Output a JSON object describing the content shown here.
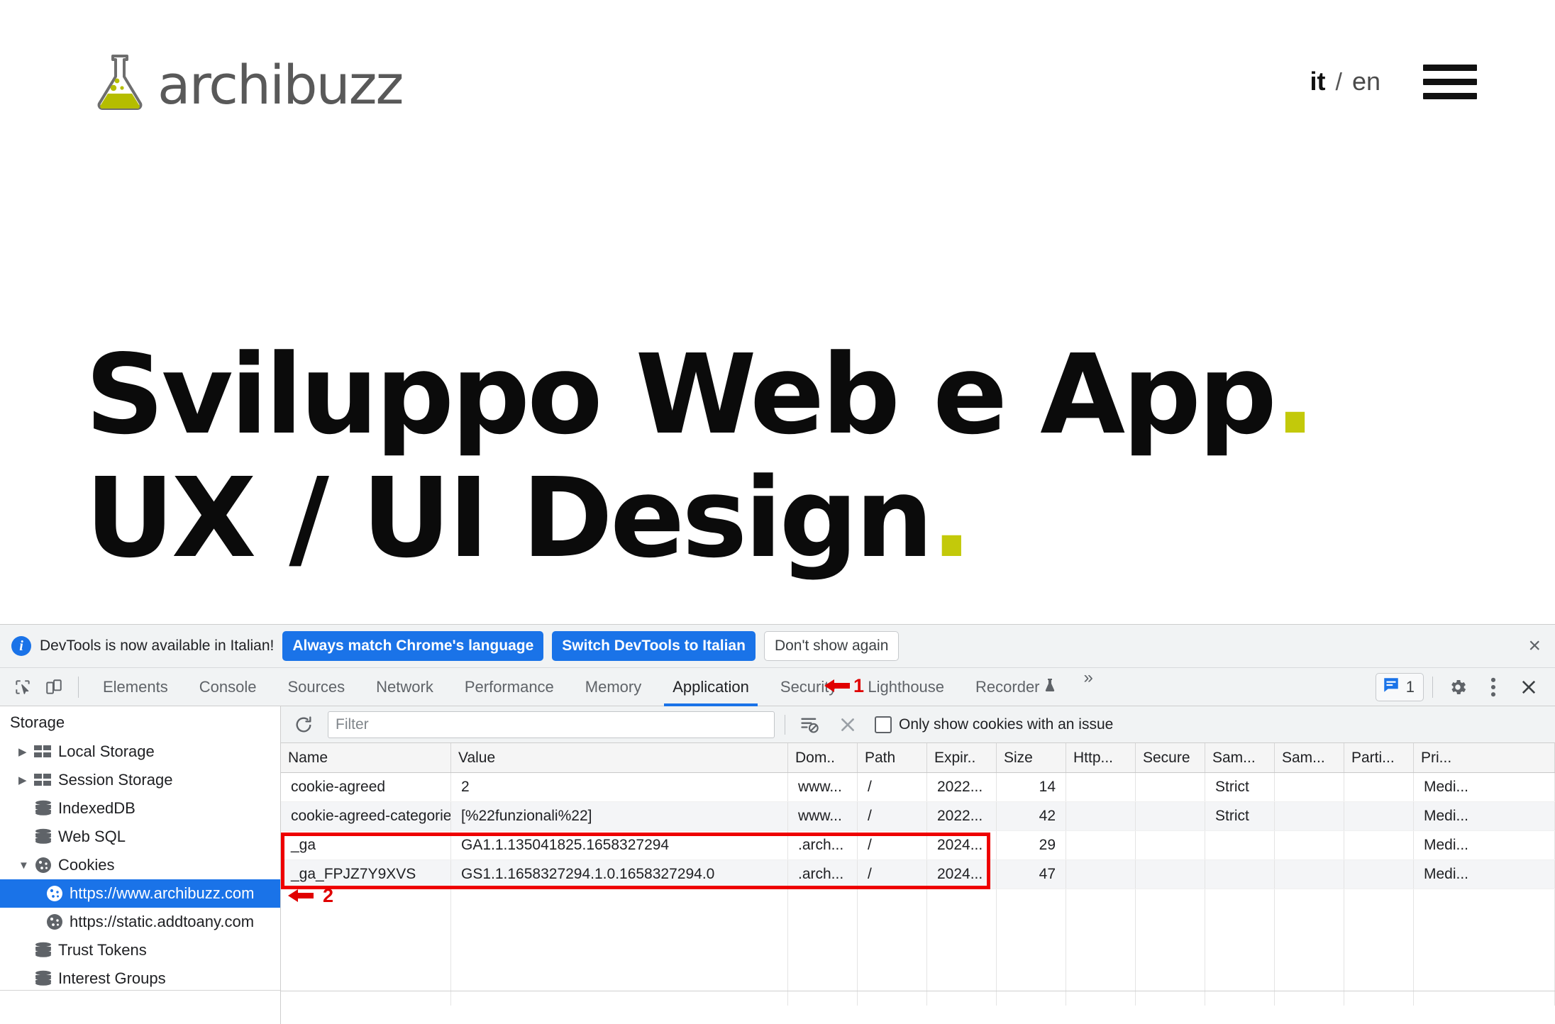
{
  "site": {
    "brand_name": "archibuzz",
    "brand_accent": "#b5bd00",
    "lang_active": "it",
    "lang_separator": "/",
    "lang_alt": "en",
    "hero_line1": "Sviluppo Web e App",
    "hero_line1_dot": ".",
    "hero_line2": "UX / UI Design",
    "hero_line2_dot": "."
  },
  "devtools": {
    "infobar": {
      "message": "DevTools is now available in Italian!",
      "btn_always_match": "Always match Chrome's language",
      "btn_switch": "Switch DevTools to Italian",
      "btn_dont_show": "Don't show again",
      "close": "×"
    },
    "tabs": [
      {
        "label": "Elements",
        "active": false
      },
      {
        "label": "Console",
        "active": false
      },
      {
        "label": "Sources",
        "active": false
      },
      {
        "label": "Network",
        "active": false
      },
      {
        "label": "Performance",
        "active": false
      },
      {
        "label": "Memory",
        "active": false
      },
      {
        "label": "Application",
        "active": true
      },
      {
        "label": "Security",
        "active": false
      },
      {
        "label": "Lighthouse",
        "active": false
      },
      {
        "label": "Recorder",
        "active": false
      }
    ],
    "tab_overflow": "»",
    "message_count": "1",
    "annotations": [
      {
        "id": "1",
        "arrow": "←",
        "label": "1",
        "color": "#e00000"
      },
      {
        "id": "2",
        "arrow": "←",
        "label": "2",
        "color": "#e00000"
      }
    ],
    "sidebar": {
      "title": "Storage",
      "items": [
        {
          "label": "Local Storage",
          "icon": "storage-grid-icon",
          "arrow": "▶",
          "expandable": true,
          "child": false,
          "selected": false
        },
        {
          "label": "Session Storage",
          "icon": "storage-grid-icon",
          "arrow": "▶",
          "expandable": true,
          "child": false,
          "selected": false
        },
        {
          "label": "IndexedDB",
          "icon": "database-icon",
          "arrow": "",
          "expandable": false,
          "child": false,
          "selected": false
        },
        {
          "label": "Web SQL",
          "icon": "database-icon",
          "arrow": "",
          "expandable": false,
          "child": false,
          "selected": false
        },
        {
          "label": "Cookies",
          "icon": "cookie-icon",
          "arrow": "▼",
          "expandable": true,
          "child": false,
          "selected": false
        },
        {
          "label": "https://www.archibuzz.com",
          "icon": "cookie-icon",
          "arrow": "",
          "expandable": false,
          "child": true,
          "selected": true
        },
        {
          "label": "https://static.addtoany.com",
          "icon": "cookie-icon",
          "arrow": "",
          "expandable": false,
          "child": true,
          "selected": false
        },
        {
          "label": "Trust Tokens",
          "icon": "database-icon",
          "arrow": "",
          "expandable": false,
          "child": false,
          "selected": false
        },
        {
          "label": "Interest Groups",
          "icon": "database-icon",
          "arrow": "",
          "expandable": false,
          "child": false,
          "selected": false
        }
      ]
    },
    "filterbar": {
      "filter_placeholder": "Filter",
      "filter_value": "",
      "checkbox_label": "Only show cookies with an issue",
      "checkbox_checked": false
    },
    "cookie_table": {
      "columns": [
        "Name",
        "Value",
        "Dom..",
        "Path",
        "Expir..",
        "Size",
        "Http...",
        "Secure",
        "Sam...",
        "Sam...",
        "Parti...",
        "Pri..."
      ],
      "rows": [
        {
          "Name": "cookie-agreed",
          "Value": "2",
          "Dom": "www...",
          "Path": "/",
          "Expir": "2022...",
          "Size": "14",
          "Http": "",
          "Secure": "",
          "SameSite": "Strict",
          "SameParty": "",
          "Partition": "",
          "Priority": "Medi..."
        },
        {
          "Name": "cookie-agreed-categories",
          "Value": "[%22funzionali%22]",
          "Dom": "www...",
          "Path": "/",
          "Expir": "2022...",
          "Size": "42",
          "Http": "",
          "Secure": "",
          "SameSite": "Strict",
          "SameParty": "",
          "Partition": "",
          "Priority": "Medi..."
        },
        {
          "Name": "_ga",
          "Value": "GA1.1.135041825.1658327294",
          "Dom": ".arch...",
          "Path": "/",
          "Expir": "2024...",
          "Size": "29",
          "Http": "",
          "Secure": "",
          "SameSite": "",
          "SameParty": "",
          "Partition": "",
          "Priority": "Medi..."
        },
        {
          "Name": "_ga_FPJZ7Y9XVS",
          "Value": "GS1.1.1658327294.1.0.1658327294.0",
          "Dom": ".arch...",
          "Path": "/",
          "Expir": "2024...",
          "Size": "47",
          "Http": "",
          "Secure": "",
          "SameSite": "",
          "SameParty": "",
          "Partition": "",
          "Priority": "Medi..."
        }
      ]
    }
  }
}
